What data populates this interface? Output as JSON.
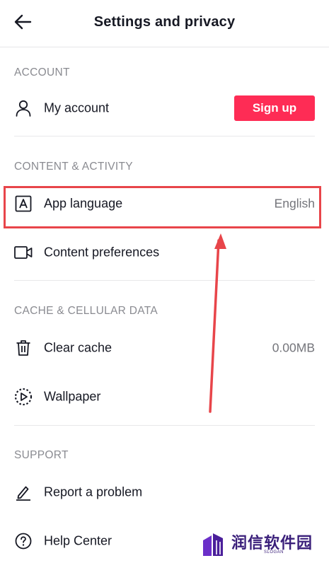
{
  "header": {
    "title": "Settings and privacy",
    "back_icon": "arrow-left-icon"
  },
  "sections": {
    "account": {
      "title": "ACCOUNT",
      "my_account_label": "My account",
      "signup_label": "Sign up"
    },
    "content_activity": {
      "title": "CONTENT & ACTIVITY",
      "app_language_label": "App language",
      "app_language_value": "English",
      "content_preferences_label": "Content preferences"
    },
    "cache": {
      "title": "CACHE & CELLULAR DATA",
      "clear_cache_label": "Clear cache",
      "clear_cache_value": "0.00MB",
      "wallpaper_label": "Wallpaper"
    },
    "support": {
      "title": "SUPPORT",
      "report_label": "Report a problem",
      "help_label": "Help Center"
    }
  },
  "watermark": {
    "text": "润信软件园",
    "sub": "SLOGAN"
  },
  "colors": {
    "accent": "#fe2c55",
    "annotation": "#e8454a"
  }
}
